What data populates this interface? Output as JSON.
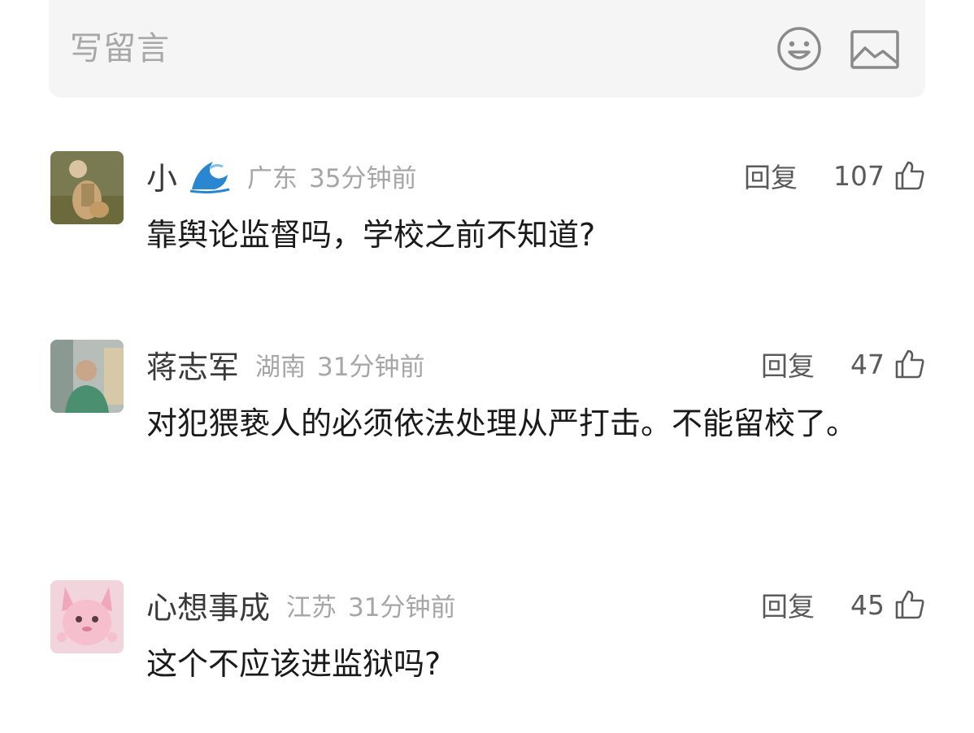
{
  "composer": {
    "placeholder": "写留言"
  },
  "comments": [
    {
      "username": "小",
      "has_badge": true,
      "location": "广东",
      "time": "35分钟前",
      "reply_label": "回复",
      "likes": "107",
      "text": "靠舆论监督吗，学校之前不知道?"
    },
    {
      "username": "蒋志军",
      "location": "湖南",
      "time": "31分钟前",
      "reply_label": "回复",
      "likes": "47",
      "text": "对犯猥亵人的必须依法处理从严打击。不能留校了。"
    },
    {
      "username": "心想事成",
      "location": "江苏",
      "time": "31分钟前",
      "reply_label": "回复",
      "likes": "45",
      "text": "这个不应该进监狱吗?"
    }
  ],
  "colors": {
    "composer_bg": "#f5f5f5",
    "placeholder": "#a8a8a8",
    "meta_gray": "#a6a6a6",
    "wave_badge": "#2a86d1"
  }
}
